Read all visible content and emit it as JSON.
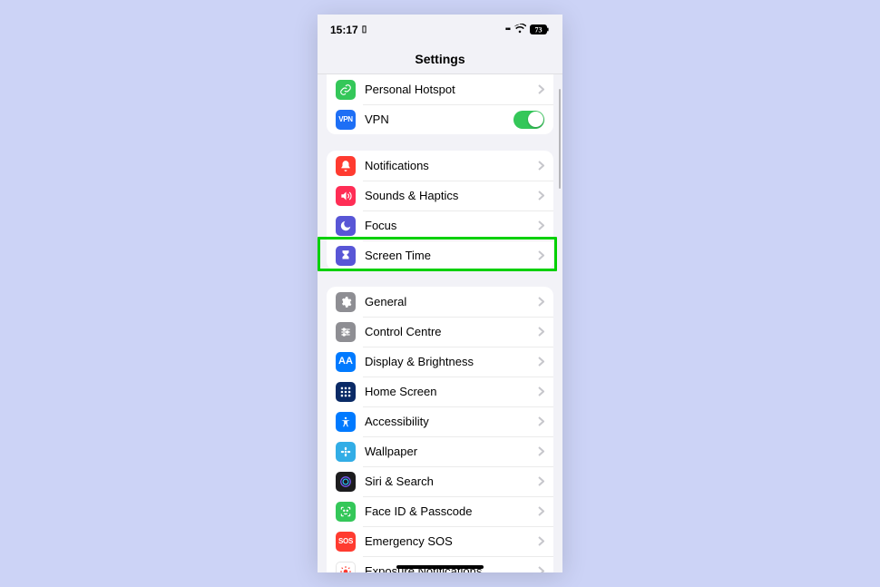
{
  "status": {
    "time": "15:17",
    "battery": "73"
  },
  "header": {
    "title": "Settings"
  },
  "groups": [
    {
      "id": "connectivity",
      "rows": [
        {
          "id": "hotspot",
          "label": "Personal Hotspot",
          "iconBg": "bg-green",
          "iconGlyph": "link",
          "accessory": "chevron"
        },
        {
          "id": "vpn",
          "label": "VPN",
          "iconBg": "bg-vpnblue",
          "iconGlyph": "vpn",
          "accessory": "toggle",
          "toggleOn": true
        }
      ]
    },
    {
      "id": "attention",
      "rows": [
        {
          "id": "notifications",
          "label": "Notifications",
          "iconBg": "bg-red",
          "iconGlyph": "bell",
          "accessory": "chevron"
        },
        {
          "id": "sounds",
          "label": "Sounds & Haptics",
          "iconBg": "bg-pink",
          "iconGlyph": "speaker",
          "accessory": "chevron"
        },
        {
          "id": "focus",
          "label": "Focus",
          "iconBg": "bg-indigo",
          "iconGlyph": "moon",
          "accessory": "chevron"
        },
        {
          "id": "screentime",
          "label": "Screen Time",
          "iconBg": "bg-indigo",
          "iconGlyph": "hourglass",
          "accessory": "chevron",
          "highlighted": true
        }
      ]
    },
    {
      "id": "general",
      "rows": [
        {
          "id": "general",
          "label": "General",
          "iconBg": "bg-grey",
          "iconGlyph": "gear",
          "accessory": "chevron"
        },
        {
          "id": "controlcentre",
          "label": "Control Centre",
          "iconBg": "bg-grey",
          "iconGlyph": "sliders",
          "accessory": "chevron"
        },
        {
          "id": "display",
          "label": "Display & Brightness",
          "iconBg": "bg-blue",
          "iconGlyph": "aa",
          "accessory": "chevron"
        },
        {
          "id": "homescreen",
          "label": "Home Screen",
          "iconBg": "bg-darkblue",
          "iconGlyph": "grid",
          "accessory": "chevron"
        },
        {
          "id": "accessibility",
          "label": "Accessibility",
          "iconBg": "bg-blue",
          "iconGlyph": "access",
          "accessory": "chevron"
        },
        {
          "id": "wallpaper",
          "label": "Wallpaper",
          "iconBg": "bg-lightblue",
          "iconGlyph": "flower",
          "accessory": "chevron"
        },
        {
          "id": "siri",
          "label": "Siri & Search",
          "iconBg": "bg-black",
          "iconGlyph": "siri",
          "accessory": "chevron"
        },
        {
          "id": "faceid",
          "label": "Face ID & Passcode",
          "iconBg": "bg-green",
          "iconGlyph": "face",
          "accessory": "chevron"
        },
        {
          "id": "sos",
          "label": "Emergency SOS",
          "iconBg": "bg-red",
          "iconGlyph": "sos",
          "accessory": "chevron"
        },
        {
          "id": "exposure",
          "label": "Exposure Notifications",
          "iconBg": "",
          "iconGlyph": "sun",
          "accessory": "chevron",
          "whiteIconBg": true
        }
      ]
    }
  ]
}
